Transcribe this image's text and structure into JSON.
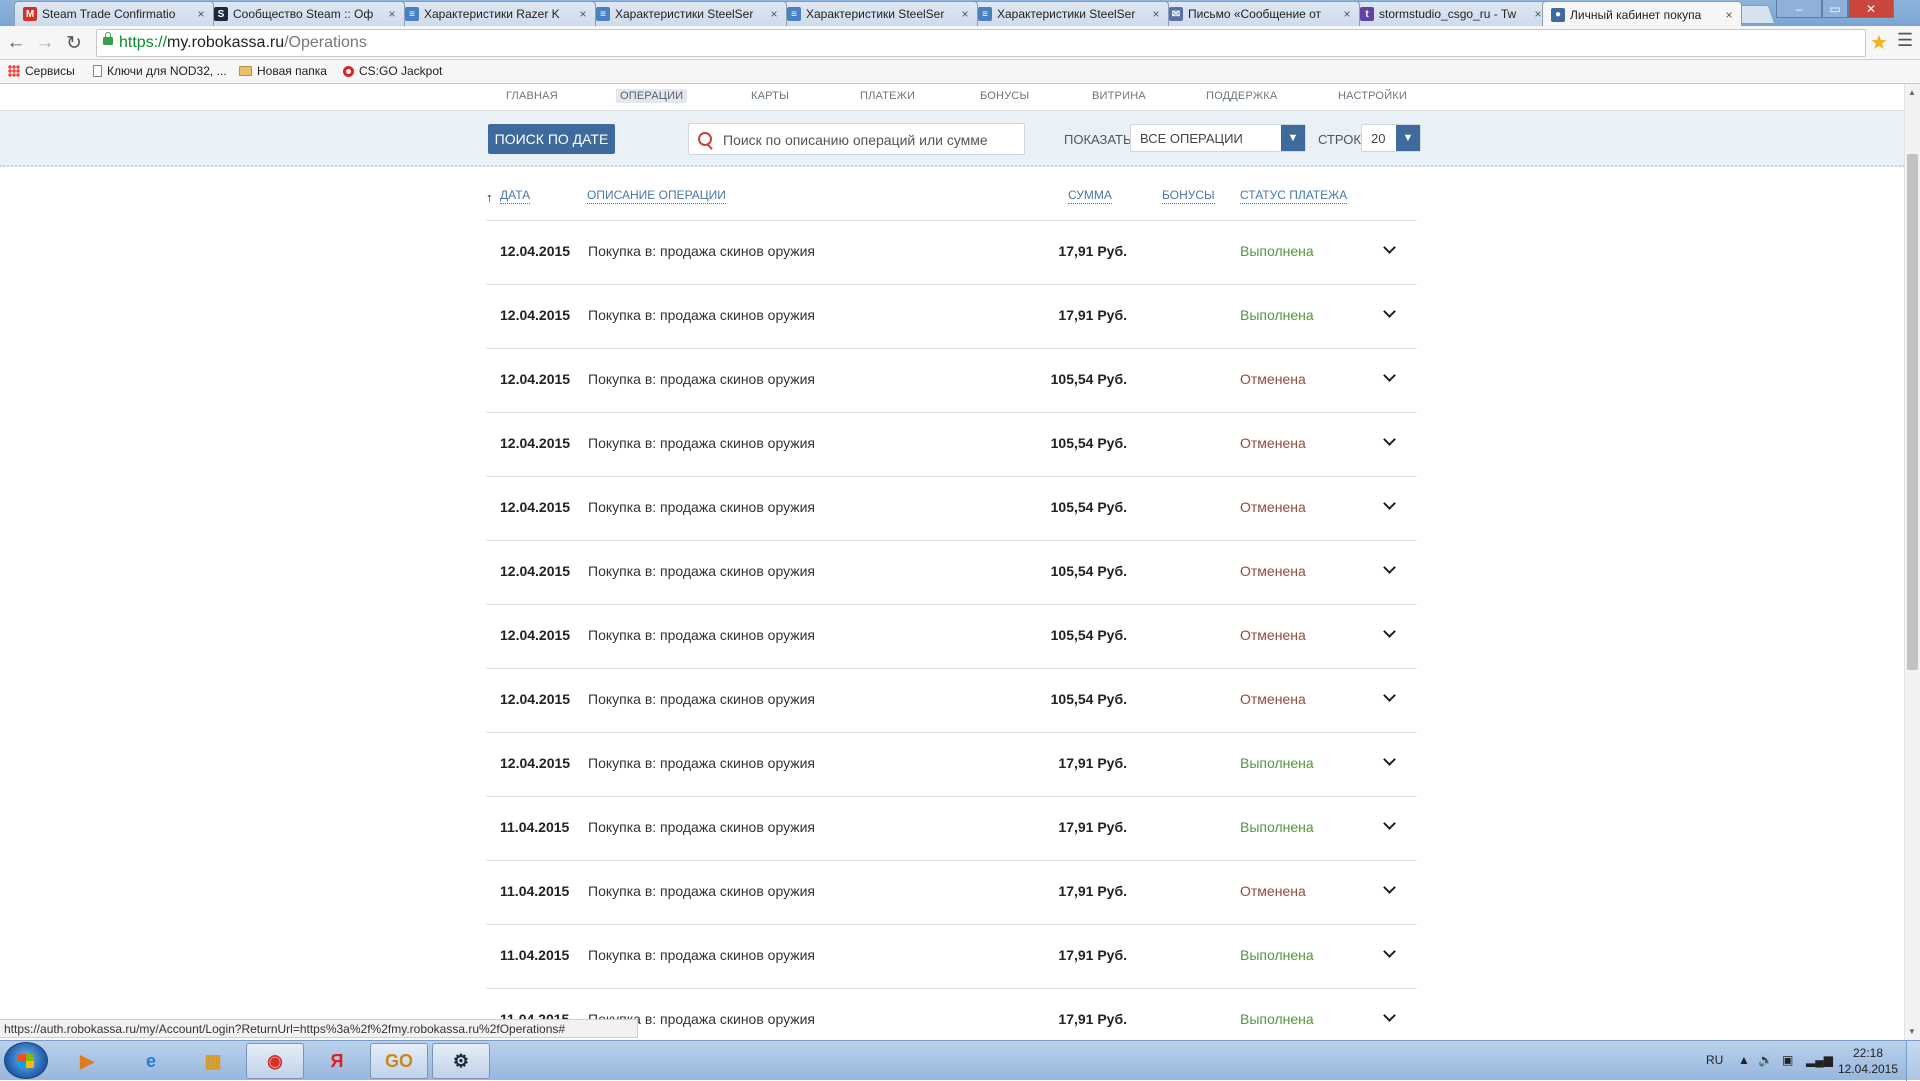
{
  "browser": {
    "tabs": [
      {
        "title": "Steam Trade Confirmatio",
        "icon": "gmail-icon",
        "icon_glyph": "M",
        "icon_color": "#d93025",
        "active": false
      },
      {
        "title": "Сообщество Steam :: Оф",
        "icon": "steam-icon",
        "icon_glyph": "S",
        "icon_color": "#1b2838",
        "active": false
      },
      {
        "title": "Характеристики Razer K",
        "icon": "page-icon",
        "icon_glyph": "≡",
        "icon_color": "#4a7fc1",
        "active": false
      },
      {
        "title": "Характеристики SteelSer",
        "icon": "page-icon",
        "icon_glyph": "≡",
        "icon_color": "#4a7fc1",
        "active": false
      },
      {
        "title": "Характеристики SteelSer",
        "icon": "page-icon",
        "icon_glyph": "≡",
        "icon_color": "#4a7fc1",
        "active": false
      },
      {
        "title": "Характеристики SteelSer",
        "icon": "page-icon",
        "icon_glyph": "≡",
        "icon_color": "#4a7fc1",
        "active": false
      },
      {
        "title": "Письмо «Сообщение от",
        "icon": "mail-icon",
        "icon_glyph": "✉",
        "icon_color": "#5b6fa8",
        "active": false
      },
      {
        "title": "stormstudio_csgo_ru - Tw",
        "icon": "twitch-icon",
        "icon_glyph": "t",
        "icon_color": "#6441a5",
        "active": false
      },
      {
        "title": "Личный кабинет покупа",
        "icon": "user-icon",
        "icon_glyph": "●",
        "icon_color": "#3f6a9e",
        "active": true
      }
    ],
    "tab_close": "×",
    "address": {
      "protocol": "https://",
      "host": "my.robokassa.ru",
      "path": "/Operations"
    },
    "bookmarks": [
      {
        "label": "Сервисы",
        "icon": "apps-icon"
      },
      {
        "label": "Ключи для NOD32, ...",
        "icon": "page-icon"
      },
      {
        "label": "Новая папка",
        "icon": "folder-icon"
      },
      {
        "label": "CS:GO Jackpot",
        "icon": "ring-icon"
      }
    ],
    "status_url": "https://auth.robokassa.ru/my/Account/Login?ReturnUrl=https%3a%2f%2fmy.robokassa.ru%2fOperations#"
  },
  "page": {
    "nav": [
      "ГЛАВНАЯ",
      "ОПЕРАЦИИ",
      "КАРТЫ",
      "ПЛАТЕЖИ",
      "БОНУСЫ",
      "ВИТРИНА",
      "ПОДДЕРЖКА",
      "НАСТРОЙКИ"
    ],
    "nav_active": "ОПЕРАЦИИ",
    "filters": {
      "date_button": "ПОИСК ПО ДАТЕ",
      "search_placeholder": "Поиск по описанию операций или сумме",
      "show_label": "ПОКАЗАТЬ",
      "show_value": "ВСЕ ОПЕРАЦИИ",
      "rows_label": "СТРОК",
      "rows_value": "20"
    },
    "table": {
      "columns": {
        "date": "ДАТА",
        "description": "ОПИСАНИЕ ОПЕРАЦИИ",
        "amount": "СУММА",
        "bonus": "БОНУСЫ",
        "status": "СТАТУС ПЛАТЕЖА"
      },
      "rows": [
        {
          "date": "12.04.2015",
          "description": "Покупка в: продажа скинов оружия",
          "amount": "17,91 Руб.",
          "status": "Выполнена",
          "state": "done"
        },
        {
          "date": "12.04.2015",
          "description": "Покупка в: продажа скинов оружия",
          "amount": "17,91 Руб.",
          "status": "Выполнена",
          "state": "done"
        },
        {
          "date": "12.04.2015",
          "description": "Покупка в: продажа скинов оружия",
          "amount": "105,54 Руб.",
          "status": "Отменена",
          "state": "cancel"
        },
        {
          "date": "12.04.2015",
          "description": "Покупка в: продажа скинов оружия",
          "amount": "105,54 Руб.",
          "status": "Отменена",
          "state": "cancel"
        },
        {
          "date": "12.04.2015",
          "description": "Покупка в: продажа скинов оружия",
          "amount": "105,54 Руб.",
          "status": "Отменена",
          "state": "cancel"
        },
        {
          "date": "12.04.2015",
          "description": "Покупка в: продажа скинов оружия",
          "amount": "105,54 Руб.",
          "status": "Отменена",
          "state": "cancel"
        },
        {
          "date": "12.04.2015",
          "description": "Покупка в: продажа скинов оружия",
          "amount": "105,54 Руб.",
          "status": "Отменена",
          "state": "cancel"
        },
        {
          "date": "12.04.2015",
          "description": "Покупка в: продажа скинов оружия",
          "amount": "105,54 Руб.",
          "status": "Отменена",
          "state": "cancel"
        },
        {
          "date": "12.04.2015",
          "description": "Покупка в: продажа скинов оружия",
          "amount": "17,91 Руб.",
          "status": "Выполнена",
          "state": "done"
        },
        {
          "date": "11.04.2015",
          "description": "Покупка в: продажа скинов оружия",
          "amount": "17,91 Руб.",
          "status": "Выполнена",
          "state": "done"
        },
        {
          "date": "11.04.2015",
          "description": "Покупка в: продажа скинов оружия",
          "amount": "17,91 Руб.",
          "status": "Отменена",
          "state": "cancel"
        },
        {
          "date": "11.04.2015",
          "description": "Покупка в: продажа скинов оружия",
          "amount": "17,91 Руб.",
          "status": "Выполнена",
          "state": "done"
        },
        {
          "date": "11.04.2015",
          "description": "Покупка в: продажа скинов оружия",
          "amount": "17,91 Руб.",
          "status": "Выполнена",
          "state": "done"
        }
      ]
    }
  },
  "taskbar": {
    "apps": [
      {
        "name": "media-player-icon",
        "glyph": "▶",
        "color": "#e07a1a",
        "open": false
      },
      {
        "name": "internet-explorer-icon",
        "glyph": "e",
        "color": "#1e7fd6",
        "open": false
      },
      {
        "name": "explorer-icon",
        "glyph": "▦",
        "color": "#d69a1f",
        "open": false
      },
      {
        "name": "chrome-icon",
        "glyph": "◉",
        "color": "#d93025",
        "open": true
      },
      {
        "name": "yandex-browser-icon",
        "glyph": "Я",
        "color": "#e02020",
        "open": false
      },
      {
        "name": "csgo-icon",
        "glyph": "GO",
        "color": "#c9881c",
        "open": true
      },
      {
        "name": "steam-icon",
        "glyph": "⚙",
        "color": "#1b2838",
        "open": true
      }
    ],
    "lang": "RU",
    "time": "22:18",
    "date": "12.04.2015"
  },
  "colors": {
    "accent": "#3f6a9e",
    "link": "#4a78a8",
    "status_done": "#4e9a3a",
    "status_cancel": "#8b4c3a"
  }
}
